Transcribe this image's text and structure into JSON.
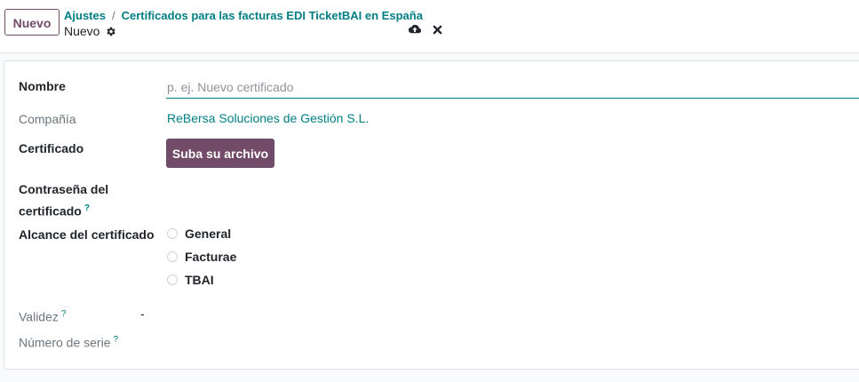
{
  "control_panel": {
    "new_button": "Nuevo",
    "breadcrumb": {
      "items": [
        "Ajustes",
        "Certificados para las facturas EDI TicketBAI en España"
      ],
      "separator": "/"
    },
    "record_title": "Nuevo"
  },
  "form": {
    "name": {
      "label": "Nombre",
      "placeholder": "p. ej. Nuevo certificado",
      "value": ""
    },
    "company": {
      "label": "Compañía",
      "value": "ReBersa Soluciones de Gestión S.L."
    },
    "certificate": {
      "label": "Certificado",
      "upload_button": "Suba su archivo"
    },
    "password": {
      "label_line1": "Contraseña del",
      "label_line2": "certificado",
      "help": "?"
    },
    "scope": {
      "label": "Alcance del certificado",
      "options": [
        "General",
        "Facturae",
        "TBAI"
      ]
    },
    "validity": {
      "label": "Validez",
      "help": "?",
      "value": "-"
    },
    "serial": {
      "label": "Número de serie",
      "help": "?"
    }
  },
  "icons": {
    "gear": "gear-icon",
    "save": "cloud-upload-icon",
    "discard": "close-icon"
  },
  "colors": {
    "brand": "#714b67",
    "link": "#017e84"
  }
}
